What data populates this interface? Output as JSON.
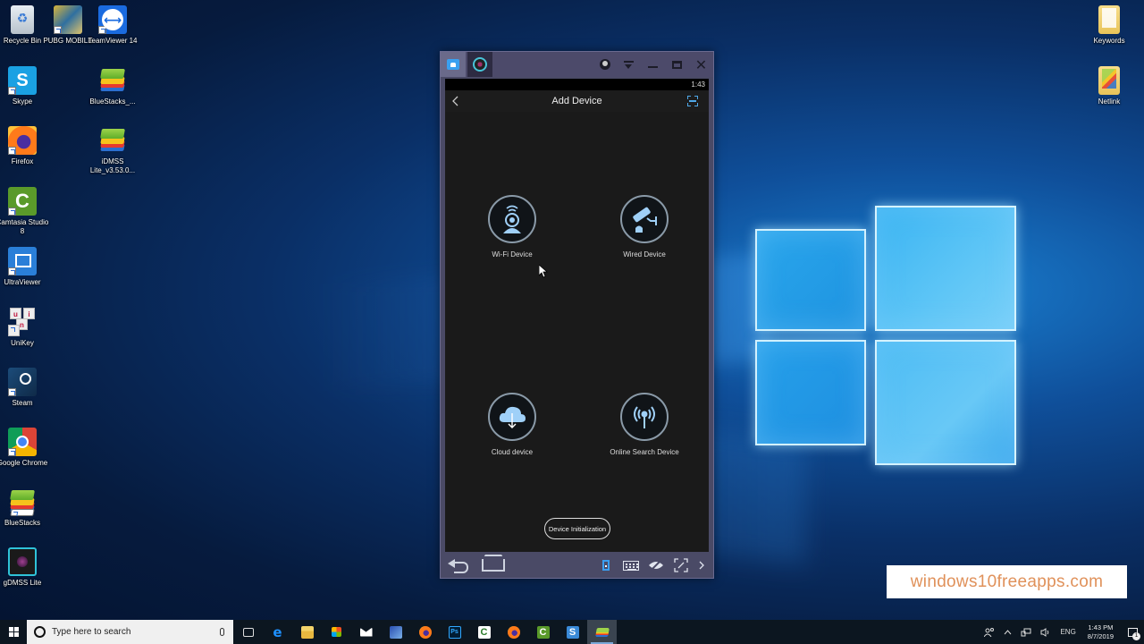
{
  "desktop": {
    "left_icons": [
      {
        "label": "Recycle Bin",
        "icon": "recycle-bin-icon"
      },
      {
        "label": "PUBG MOBILE",
        "icon": "pubg-mobile-icon"
      },
      {
        "label": "TeamViewer 14",
        "icon": "teamviewer-icon"
      },
      {
        "label": "Skype",
        "icon": "skype-icon"
      },
      {
        "label": "BlueStacks_...",
        "icon": "bluestacks-installer-icon"
      },
      {
        "label": "Firefox",
        "icon": "firefox-icon"
      },
      {
        "label": "iDMSS Lite_v3.53.0...",
        "icon": "idmss-lite-icon"
      },
      {
        "label": "Camtasia Studio 8",
        "icon": "camtasia-icon"
      },
      {
        "label": "UltraViewer",
        "icon": "ultraviewer-icon"
      },
      {
        "label": "UniKey",
        "icon": "unikey-icon"
      },
      {
        "label": "Steam",
        "icon": "steam-icon"
      },
      {
        "label": "Google Chrome",
        "icon": "chrome-icon"
      },
      {
        "label": "BlueStacks",
        "icon": "bluestacks-icon"
      },
      {
        "label": "gDMSS Lite",
        "icon": "gdmss-lite-icon"
      }
    ],
    "right_icons": [
      {
        "label": "Keywords",
        "icon": "folder-icon"
      },
      {
        "label": "Netlink",
        "icon": "folder-icon"
      }
    ]
  },
  "emulator": {
    "tabs": [
      {
        "name": "home",
        "icon": "home-icon"
      },
      {
        "name": "gDMSS",
        "icon": "camera-app-icon"
      }
    ],
    "window_controls": [
      "account",
      "menu",
      "minimize",
      "maximize",
      "close"
    ],
    "status_time": "1:43",
    "screen": {
      "title": "Add Device",
      "options": [
        {
          "label": "Wi-Fi Device",
          "icon": "wifi-camera-icon"
        },
        {
          "label": "Wired Device",
          "icon": "wired-camera-icon"
        },
        {
          "label": "Cloud device",
          "icon": "cloud-download-icon"
        },
        {
          "label": "Online Search Device",
          "icon": "broadcast-search-icon"
        }
      ],
      "init_button": "Device Initialization"
    },
    "accent": "#4fa8e8"
  },
  "watermark": "windows10freeapps.com",
  "taskbar": {
    "search_placeholder": "Type here to search",
    "apps": [
      "task-view",
      "edge",
      "file-explorer",
      "store",
      "mail",
      "network-app",
      "firefox",
      "photoshop",
      "camtasia-recorder",
      "firefox-2",
      "camtasia-studio",
      "snagit",
      "bluestacks"
    ],
    "photoshop_label": "Ps",
    "camtasia_label": "C",
    "snagit_label": "S",
    "tray": {
      "language": "ENG",
      "time": "1:43 PM",
      "date": "8/7/2019",
      "notification_count": "1"
    }
  }
}
